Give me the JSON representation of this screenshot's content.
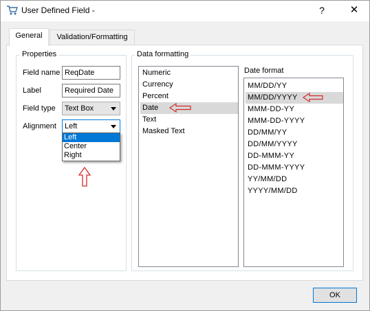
{
  "window": {
    "title": "User Defined Field -",
    "help_glyph": "?",
    "close_glyph": "✕"
  },
  "tabs": [
    {
      "label": "General"
    },
    {
      "label": "Validation/Formatting"
    }
  ],
  "properties": {
    "group_label": "Properties",
    "field_name": {
      "label": "Field name",
      "value": "ReqDate"
    },
    "label": {
      "label": "Label",
      "value": "Required Date"
    },
    "field_type": {
      "label": "Field type",
      "value": "Text Box"
    },
    "alignment": {
      "label": "Alignment",
      "value": "Left",
      "options": [
        "Left",
        "Center",
        "Right"
      ]
    }
  },
  "data_formatting": {
    "group_label": "Data formatting",
    "types": [
      "Numeric",
      "Currency",
      "Percent",
      "Date",
      "Text",
      "Masked Text"
    ],
    "selected_type": "Date",
    "date_format_label": "Date format",
    "date_formats": [
      "MM/DD/YY",
      "MM/DD/YYYY",
      "MMM-DD-YY",
      "MMM-DD-YYYY",
      "DD/MM/YY",
      "DD/MM/YYYY",
      "DD-MMM-YY",
      "DD-MMM-YYYY",
      "YY/MM/DD",
      "YYYY/MM/DD"
    ],
    "selected_format": "MM/DD/YYYY"
  },
  "buttons": {
    "ok": "OK"
  },
  "annotations": {
    "arrow_color": "#d42a2a"
  }
}
